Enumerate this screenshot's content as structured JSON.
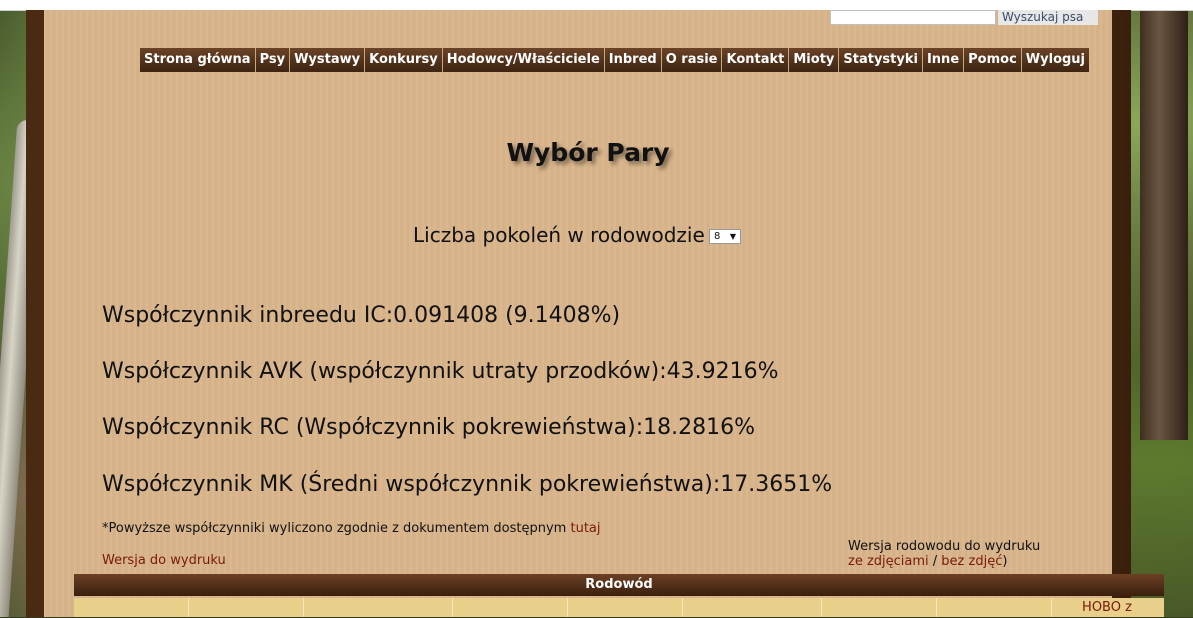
{
  "search": {
    "placeholder": "",
    "button_label": "Wyszukaj psa"
  },
  "nav": {
    "items": [
      "Strona główna",
      "Psy",
      "Wystawy",
      "Konkursy",
      "Hodowcy/Właściciele",
      "Inbred",
      "O rasie",
      "Kontakt",
      "Mioty",
      "Statystyki",
      "Inne",
      "Pomoc",
      "Wyloguj"
    ]
  },
  "page": {
    "title": "Wybór Pary",
    "generations_label": "Liczba pokoleń w rodowodzie",
    "generations_value": "8"
  },
  "coefficients": [
    "Współczynnik inbreedu IC:0.091408 (9.1408%)",
    "Współczynnik AVK (współczynnik utraty przodków):43.9216%",
    "Współczynnik RC (Współczynnik pokrewieństwa):18.2816%",
    "Współczynnik MK (Średni współczynnik pokrewieństwa):17.3651%"
  ],
  "note": {
    "text": "*Powyższe współczynniki wyliczono zgodnie z dokumentem dostępnym ",
    "link": "tutaj"
  },
  "print": {
    "left_link": "Wersja do wydruku",
    "right_label": "Wersja rodowodu do wydruku",
    "with_photos": "ze zdjęciami",
    "separator": " / ",
    "without_photos": "bez zdjęć",
    "close_paren": ")"
  },
  "pedigree": {
    "title": "Rodowód",
    "last_cell": "HOBO z"
  },
  "colors": {
    "panel": "#d8b48a",
    "nav_bg": "#4a2e18",
    "link": "#7a1a0a",
    "table_cell": "#e8cf8a"
  }
}
